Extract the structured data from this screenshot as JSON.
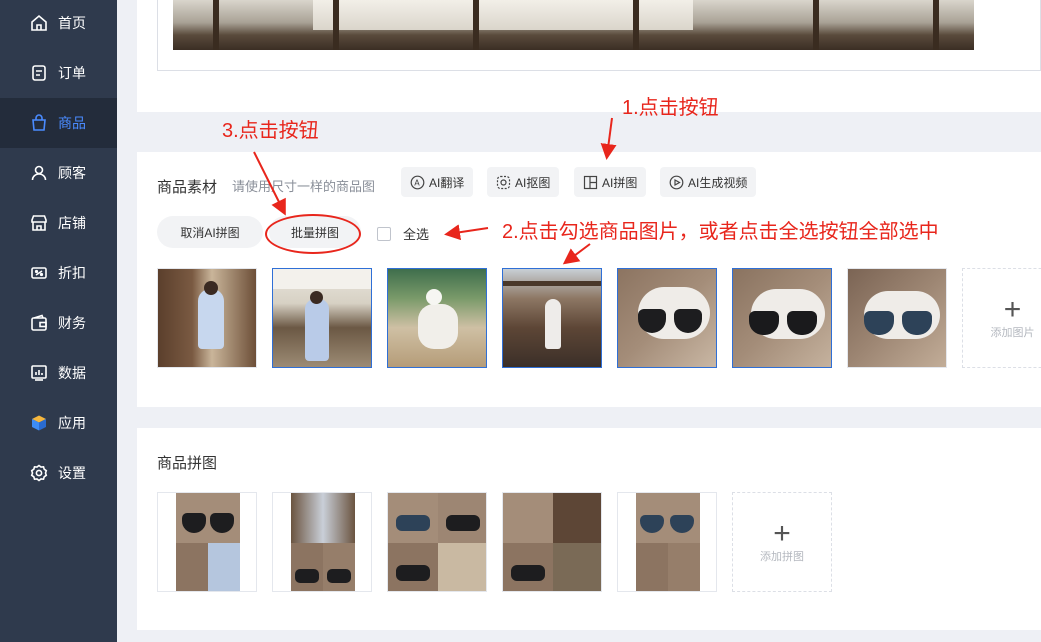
{
  "sidebar": {
    "items": [
      {
        "label": "首页",
        "icon": "home-icon"
      },
      {
        "label": "订单",
        "icon": "order-icon"
      },
      {
        "label": "商品",
        "icon": "bag-icon",
        "active": true
      },
      {
        "label": "顾客",
        "icon": "user-icon"
      },
      {
        "label": "店铺",
        "icon": "store-icon"
      },
      {
        "label": "折扣",
        "icon": "discount-icon"
      },
      {
        "label": "财务",
        "icon": "wallet-icon"
      },
      {
        "label": "数据",
        "icon": "chart-icon"
      },
      {
        "label": "应用",
        "icon": "cube-icon"
      },
      {
        "label": "设置",
        "icon": "gear-icon"
      }
    ]
  },
  "materials": {
    "title": "商品素材",
    "hint": "请使用尺寸一样的商品图",
    "tools": [
      {
        "label": "AI翻译",
        "icon": "translate-icon"
      },
      {
        "label": "AI抠图",
        "icon": "cutout-icon"
      },
      {
        "label": "AI拼图",
        "icon": "collage-icon"
      },
      {
        "label": "AI生成视频",
        "icon": "video-icon"
      }
    ],
    "cancel_label": "取消AI拼图",
    "batch_label": "批量拼图",
    "select_all_label": "全选",
    "add_image_label": "添加图片"
  },
  "collage": {
    "title": "商品拼图",
    "add_label": "添加拼图"
  },
  "annotations": {
    "step1": "1.点击按钮",
    "step2": "2.点击勾选商品图片，或者点击全选按钮全部选中",
    "step3": "3.点击按钮"
  },
  "colors": {
    "sidebar_bg": "#2f3a4d",
    "active_blue": "#4a8bff",
    "annotation_red": "#e8261c",
    "selected_border": "#2f6fd6"
  }
}
